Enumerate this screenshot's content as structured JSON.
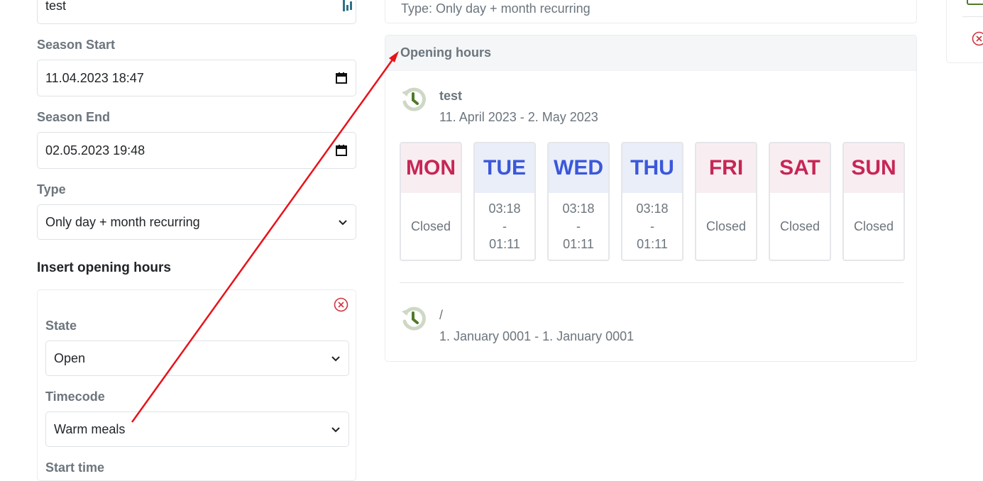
{
  "form": {
    "name_value": "test",
    "season_start_label": "Season Start",
    "season_start_value": "11.04.2023 18:47",
    "season_end_label": "Season End",
    "season_end_value": "02.05.2023 19:48",
    "type_label": "Type",
    "type_value": "Only day + month recurring",
    "insert_title": "Insert opening hours",
    "state_label": "State",
    "state_value": "Open",
    "timecode_label": "Timecode",
    "timecode_value": "Warm meals",
    "start_time_label": "Start time"
  },
  "summary": {
    "type_text": "Type: Only day + month recurring"
  },
  "opening_hours": {
    "title": "Opening hours",
    "entries": [
      {
        "title": "test",
        "range": "11. April 2023 - 2. May 2023",
        "days": [
          {
            "label": "MON",
            "status": "closed",
            "text": "Closed"
          },
          {
            "label": "TUE",
            "status": "open",
            "from": "03:18",
            "sep": "-",
            "to": "01:11"
          },
          {
            "label": "WED",
            "status": "open",
            "from": "03:18",
            "sep": "-",
            "to": "01:11"
          },
          {
            "label": "THU",
            "status": "open",
            "from": "03:18",
            "sep": "-",
            "to": "01:11"
          },
          {
            "label": "FRI",
            "status": "closed",
            "text": "Closed"
          },
          {
            "label": "SAT",
            "status": "closed",
            "text": "Closed"
          },
          {
            "label": "SUN",
            "status": "closed",
            "text": "Closed"
          }
        ]
      },
      {
        "title": "/",
        "range": "1. January 0001 - 1. January 0001"
      }
    ]
  },
  "colors": {
    "closed": "#c72655",
    "open": "#3b57db",
    "annotation_arrow": "#e8121a",
    "remove": "#d0343f",
    "history_icon": "#4f7a2a"
  }
}
